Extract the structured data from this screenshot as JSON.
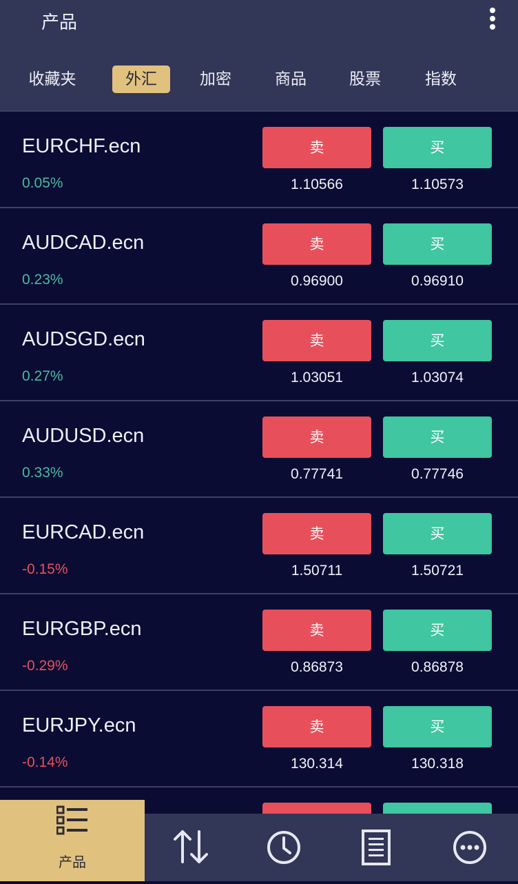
{
  "header": {
    "title": "产品",
    "tabs": [
      "收藏夹",
      "外汇",
      "加密",
      "商品",
      "股票",
      "指数"
    ],
    "active_tab": "外汇"
  },
  "buttons": {
    "sell": "卖",
    "buy": "买"
  },
  "rows": [
    {
      "symbol": "EURCHF.ecn",
      "change": "0.05%",
      "direction": "up",
      "bid": "1.10566",
      "ask": "1.10573"
    },
    {
      "symbol": "AUDCAD.ecn",
      "change": "0.23%",
      "direction": "up",
      "bid": "0.96900",
      "ask": "0.96910"
    },
    {
      "symbol": "AUDSGD.ecn",
      "change": "0.27%",
      "direction": "up",
      "bid": "1.03051",
      "ask": "1.03074"
    },
    {
      "symbol": "AUDUSD.ecn",
      "change": "0.33%",
      "direction": "up",
      "bid": "0.77741",
      "ask": "0.77746"
    },
    {
      "symbol": "EURCAD.ecn",
      "change": "-0.15%",
      "direction": "down",
      "bid": "1.50711",
      "ask": "1.50721"
    },
    {
      "symbol": "EURGBP.ecn",
      "change": "-0.29%",
      "direction": "down",
      "bid": "0.86873",
      "ask": "0.86878"
    },
    {
      "symbol": "EURJPY.ecn",
      "change": "-0.14%",
      "direction": "down",
      "bid": "130.314",
      "ask": "130.318"
    }
  ],
  "bottom_nav": {
    "items": [
      {
        "label": "产品",
        "icon": "list-icon",
        "active": true
      },
      {
        "label": "",
        "icon": "transfer-arrows-icon",
        "active": false
      },
      {
        "label": "",
        "icon": "clock-icon",
        "active": false
      },
      {
        "label": "",
        "icon": "document-icon",
        "active": false
      },
      {
        "label": "",
        "icon": "more-circle-icon",
        "active": false
      }
    ]
  },
  "colors": {
    "background": "#0b0c33",
    "header": "#323657",
    "accent": "#e1c17e",
    "sell": "#e7505b",
    "buy": "#40c6a0",
    "up": "#4ab9a0",
    "down": "#e8505a"
  }
}
